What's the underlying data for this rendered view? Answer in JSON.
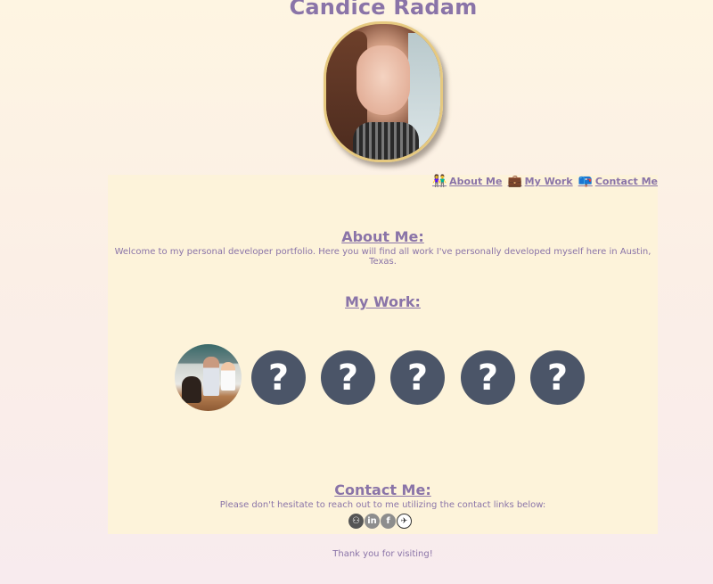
{
  "header": {
    "title": "Candice Radam"
  },
  "nav": {
    "items": [
      {
        "label": "About Me",
        "icon": "people-icon",
        "glyph": "👫"
      },
      {
        "label": "My Work",
        "icon": "briefcase-icon",
        "glyph": "💼"
      },
      {
        "label": "Contact Me",
        "icon": "mailbox-icon",
        "glyph": "📪"
      }
    ]
  },
  "about": {
    "heading": "About Me:",
    "text": "Welcome to my personal developer portfolio. Here you will find all work I've personally developed myself here in Austin, Texas."
  },
  "work": {
    "heading": "My Work:",
    "placeholder_glyph": "?"
  },
  "contact": {
    "heading": "Contact Me:",
    "text": "Please don't hesitate to reach out to me utilizing the contact links below:",
    "links": [
      {
        "icon": "github-icon",
        "glyph": "⚇"
      },
      {
        "icon": "linkedin-icon",
        "glyph": "in"
      },
      {
        "icon": "facebook-icon",
        "glyph": "f"
      },
      {
        "icon": "email-icon",
        "glyph": "✈"
      }
    ]
  },
  "footer": {
    "text": "Thank you for visiting!"
  },
  "colors": {
    "accent": "#8a74a8",
    "panel": "#fdf3da",
    "placeholder_circle": "#4b5568",
    "avatar_border": "#e6c97f"
  }
}
